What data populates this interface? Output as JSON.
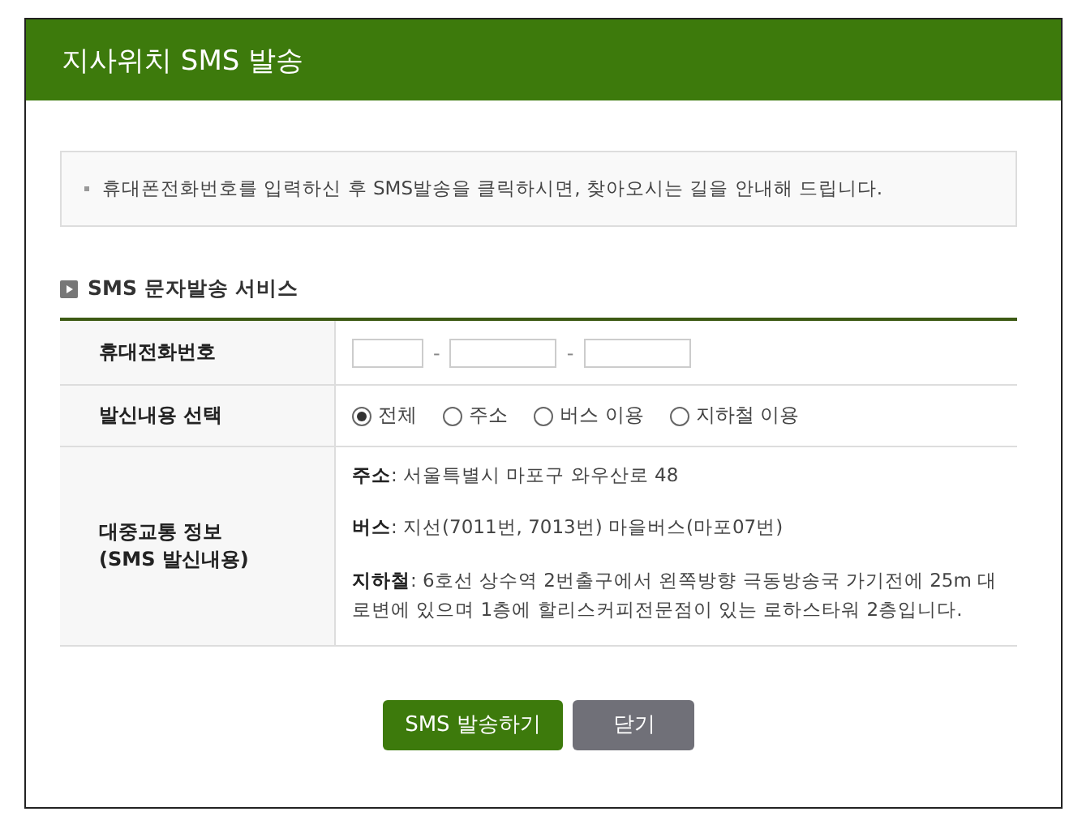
{
  "window": {
    "title": "지사위치 SMS 발송"
  },
  "notice": "휴대폰전화번호를 입력하신 후 SMS발송을 클릭하시면, 찾아오시는 길을 안내해 드립니다.",
  "section_title": "SMS 문자발송 서비스",
  "form": {
    "phone_label": "휴대전화번호",
    "phone_separators": [
      "-",
      "-"
    ],
    "content_label": "발신내용 선택",
    "options": [
      {
        "label": "전체",
        "selected": true
      },
      {
        "label": "주소",
        "selected": false
      },
      {
        "label": "버스 이용",
        "selected": false
      },
      {
        "label": "지하철 이용",
        "selected": false
      }
    ],
    "transit_label": [
      "대중교통 정보",
      "(SMS 발신내용)"
    ],
    "transit_info": [
      "**주소**: 서울특별시 마포구 와우산로 48",
      "**버스**: 지선(7011번, 7013번) 마을버스(마포07번)",
      "**지하철**: 6호선 상수역 2번출구에서 왼쪽방향 극동방송국 가기전에 25m 대로변에 있으며 1층에 할리스커피전문점이 있는 로하스타워 2층입니다."
    ]
  },
  "buttons": [
    {
      "label": "SMS 발송하기",
      "kind": "primary"
    },
    {
      "label": "닫기",
      "kind": "secondary"
    }
  ]
}
